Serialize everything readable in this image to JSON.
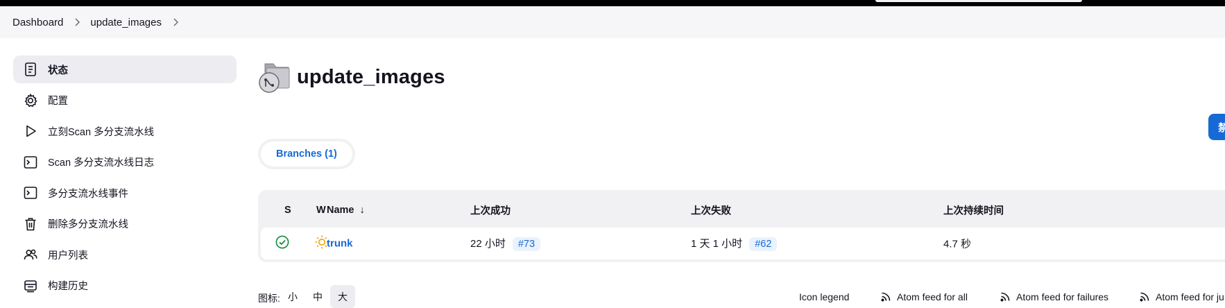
{
  "breadcrumb": [
    "Dashboard",
    "update_images"
  ],
  "sidebar": {
    "items": [
      {
        "label": "状态",
        "icon": "document-icon"
      },
      {
        "label": "配置",
        "icon": "gear-icon"
      },
      {
        "label": "立刻Scan 多分支流水线",
        "icon": "play-icon"
      },
      {
        "label": "Scan 多分支流水线日志",
        "icon": "terminal-icon"
      },
      {
        "label": "多分支流水线事件",
        "icon": "terminal-icon"
      },
      {
        "label": "删除多分支流水线",
        "icon": "trash-icon"
      },
      {
        "label": "用户列表",
        "icon": "users-icon"
      },
      {
        "label": "构建历史",
        "icon": "history-icon"
      }
    ]
  },
  "page": {
    "title": "update_images",
    "title_icon": "multibranch-folder-icon",
    "action_button_label": "禁"
  },
  "tabs": [
    {
      "label": "Branches (1)"
    }
  ],
  "table": {
    "headers": {
      "s": "S",
      "w": "W",
      "name": "Name",
      "sort_arrow": "↓",
      "last_success": "上次成功",
      "last_failure": "上次失败",
      "last_duration": "上次持续时间"
    },
    "rows": [
      {
        "status_icon": "success-check-icon",
        "weather_icon": "sunny-icon",
        "name": "trunk",
        "last_success": "22 小时",
        "last_success_build": "#73",
        "last_failure": "1 天 1 小时",
        "last_failure_build": "#62",
        "last_duration": "4.7 秒"
      }
    ]
  },
  "footer": {
    "icon_label": "图标:",
    "sizes": [
      "小",
      "中",
      "大"
    ],
    "selected_size": "大",
    "links": [
      "Icon legend",
      "Atom feed for all",
      "Atom feed for failures",
      "Atom feed for ju"
    ]
  },
  "colors": {
    "accent": "#1769d6",
    "success": "#138a36",
    "weather": "#f0a500",
    "topbar": "#000000"
  }
}
